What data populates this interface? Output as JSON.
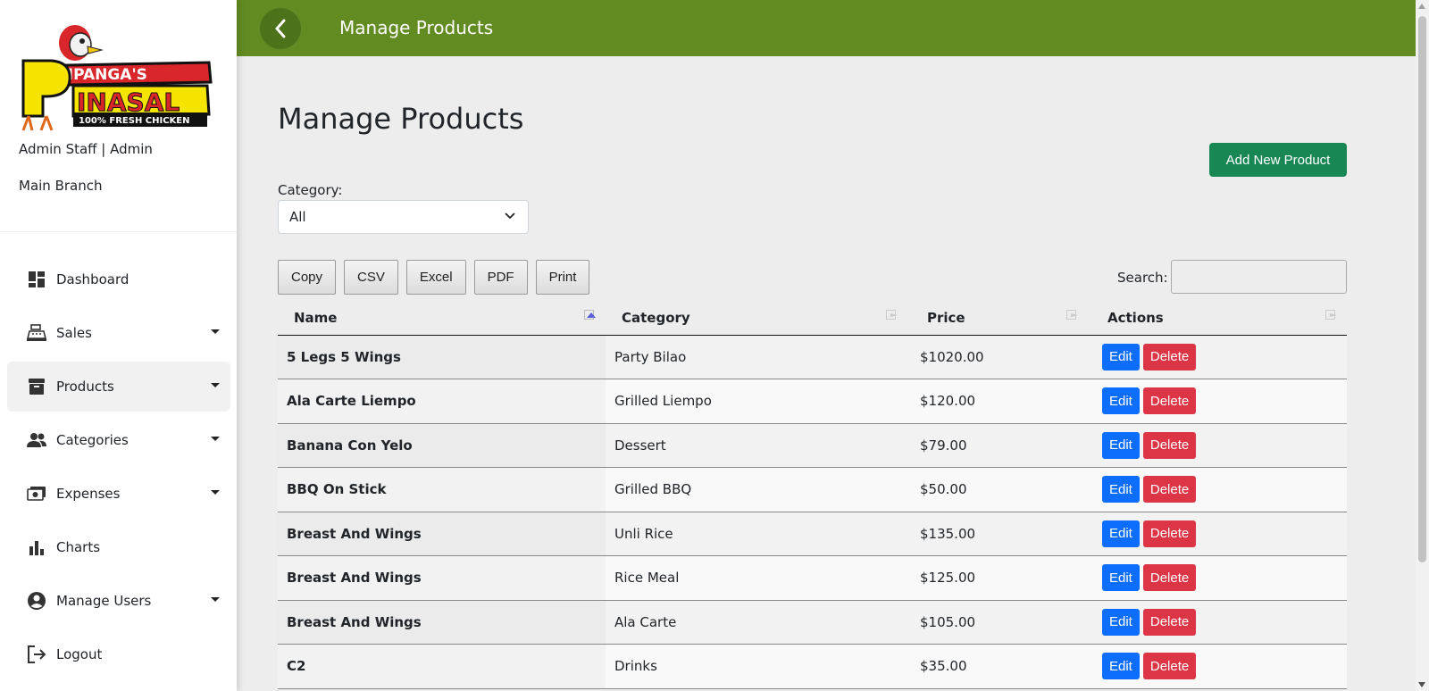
{
  "app": {
    "logo_text_top": "AMPANGA'S",
    "logo_text_main": "PINASAL",
    "logo_tagline": "100% FRESH CHICKEN"
  },
  "sidebar": {
    "user": "Admin Staff | Admin",
    "branch": "Main Branch",
    "items": [
      {
        "label": "Dashboard",
        "icon": "dashboard-icon",
        "has_caret": false,
        "active": false
      },
      {
        "label": "Sales",
        "icon": "cash-register-icon",
        "has_caret": true,
        "active": false
      },
      {
        "label": "Products",
        "icon": "archive-box-icon",
        "has_caret": true,
        "active": true
      },
      {
        "label": "Categories",
        "icon": "people-icon",
        "has_caret": true,
        "active": false
      },
      {
        "label": "Expenses",
        "icon": "money-icon",
        "has_caret": true,
        "active": false
      },
      {
        "label": "Charts",
        "icon": "bar-chart-icon",
        "has_caret": false,
        "active": false
      },
      {
        "label": "Manage Users",
        "icon": "user-circle-icon",
        "has_caret": true,
        "active": false
      },
      {
        "label": "Logout",
        "icon": "logout-icon",
        "has_caret": false,
        "active": false
      }
    ]
  },
  "header": {
    "title": "Manage Products"
  },
  "main": {
    "title": "Manage Products",
    "add_button": "Add New Product",
    "category_label": "Category:",
    "category_value": "All",
    "export_buttons": [
      "Copy",
      "CSV",
      "Excel",
      "PDF",
      "Print"
    ],
    "search_label": "Search:",
    "search_value": ""
  },
  "table": {
    "columns": [
      "Name",
      "Category",
      "Price",
      "Actions"
    ],
    "edit_label": "Edit",
    "delete_label": "Delete",
    "rows": [
      {
        "name": "5 Legs 5 Wings",
        "category": "Party Bilao",
        "price": "$1020.00"
      },
      {
        "name": "Ala Carte Liempo",
        "category": "Grilled Liempo",
        "price": "$120.00"
      },
      {
        "name": "Banana Con Yelo",
        "category": "Dessert",
        "price": "$79.00"
      },
      {
        "name": "BBQ On Stick",
        "category": "Grilled BBQ",
        "price": "$50.00"
      },
      {
        "name": "Breast And Wings",
        "category": "Unli Rice",
        "price": "$135.00"
      },
      {
        "name": "Breast And Wings",
        "category": "Rice Meal",
        "price": "$125.00"
      },
      {
        "name": "Breast And Wings",
        "category": "Ala Carte",
        "price": "$105.00"
      },
      {
        "name": "C2",
        "category": "Drinks",
        "price": "$35.00"
      }
    ]
  },
  "colors": {
    "topbar": "#628b22",
    "add_button": "#198754",
    "edit": "#0d6efd",
    "delete": "#dc3545"
  }
}
